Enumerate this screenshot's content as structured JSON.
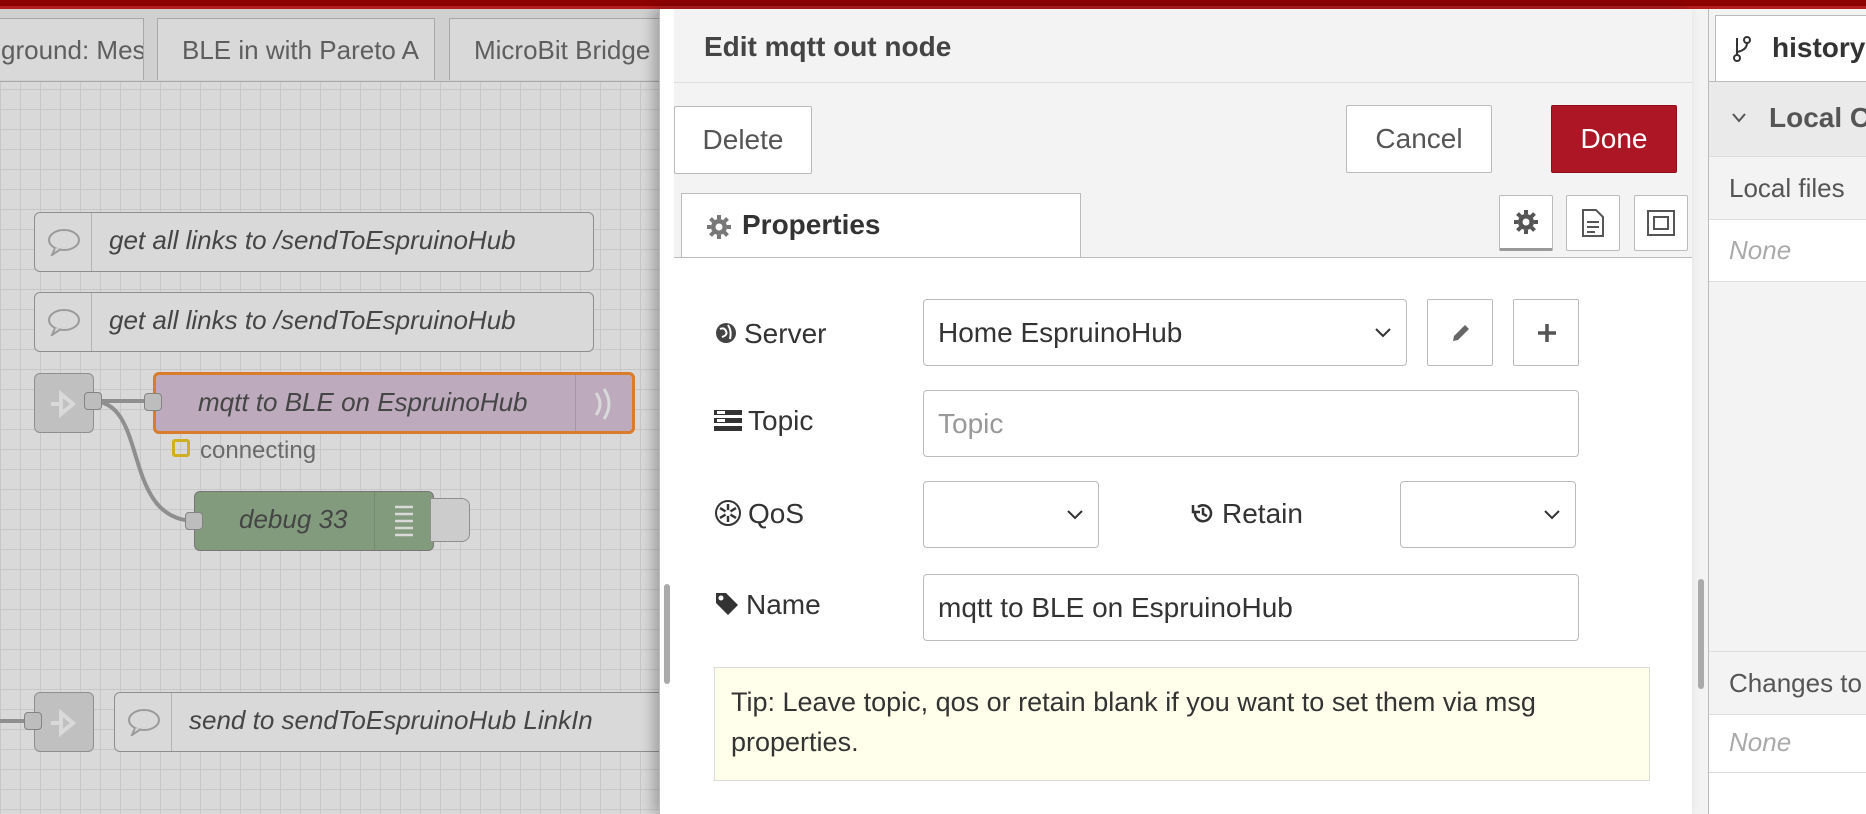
{
  "workspace": {
    "tabs": [
      "ground: Mes",
      "BLE in with Pareto A",
      "MicroBit Bridge"
    ],
    "nodes": {
      "comment1": "get all links to /sendToEspruinoHub",
      "comment2": "get all links to /sendToEspruinoHub",
      "mqtt_node": "mqtt to BLE on EspruinoHub",
      "mqtt_status": "connecting",
      "debug_node": "debug 33",
      "comment3": "send to sendToEspruinoHub LinkIn"
    }
  },
  "tray": {
    "title": "Edit mqtt out node",
    "delete_label": "Delete",
    "cancel_label": "Cancel",
    "done_label": "Done",
    "properties_tab": "Properties",
    "form": {
      "server_label": "Server",
      "server_value": "Home EspruinoHub",
      "topic_label": "Topic",
      "topic_placeholder": "Topic",
      "qos_label": "QoS",
      "qos_value": "",
      "retain_label": "Retain",
      "retain_value": "",
      "name_label": "Name",
      "name_value": "mqtt to BLE on EspruinoHub"
    },
    "tip": "Tip: Leave topic, qos or retain blank if you want to set them via msg properties."
  },
  "sidebar": {
    "tab_label": "history",
    "section_title": "Local C",
    "local_files_label": "Local files",
    "local_files_value": "None",
    "changes_label": "Changes to",
    "changes_value": "None"
  },
  "colors": {
    "done_button": "#ad1625",
    "topbar": "#8f0000",
    "mqtt_node_fill": "#d8bfd8",
    "mqtt_node_border": "#ff7f0e",
    "debug_node_fill": "#87a980",
    "tip_background": "#ffffec"
  }
}
